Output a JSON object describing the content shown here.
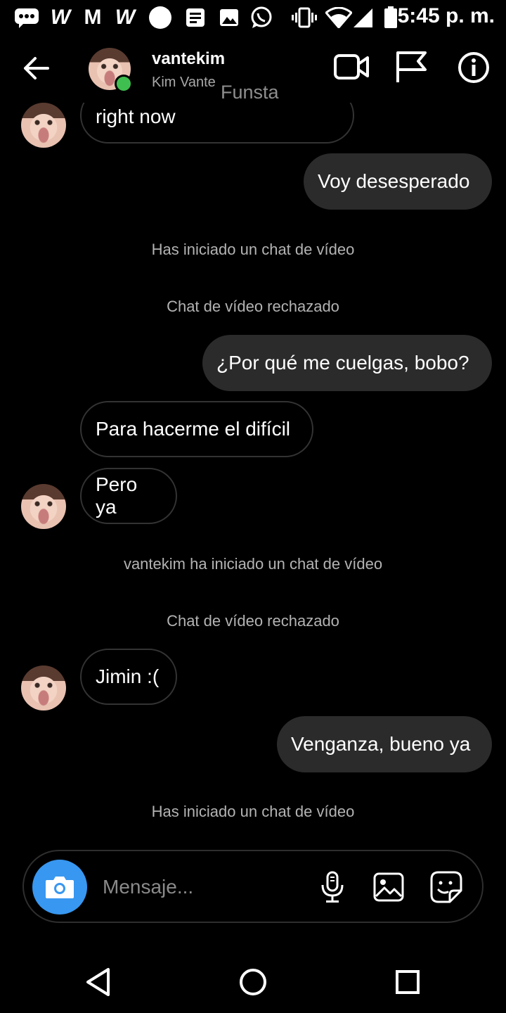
{
  "status_bar": {
    "time": "5:45 p. m.",
    "icons": [
      "message-icon",
      "wattpad-icon",
      "gmail-icon",
      "wattpad-icon",
      "circle-icon",
      "notes-icon",
      "gallery-icon",
      "whatsapp-icon",
      "vibrate-icon",
      "wifi-icon",
      "signal-icon",
      "battery-icon"
    ],
    "wattpad_glyph": "W",
    "gmail_glyph": "M"
  },
  "header": {
    "username": "vantekim",
    "full_name": "Kim Vante",
    "watermark": "Funsta",
    "online": true,
    "actions": [
      "video-call-icon",
      "flag-icon",
      "info-icon"
    ]
  },
  "messages": [
    {
      "type": "incoming",
      "text": "right now",
      "avatar": true
    },
    {
      "type": "outgoing",
      "text": "Voy desesperado"
    },
    {
      "type": "system",
      "text": "Has iniciado un chat de vídeo"
    },
    {
      "type": "system",
      "text": "Chat de vídeo rechazado"
    },
    {
      "type": "outgoing",
      "text": "¿Por qué me cuelgas, bobo?"
    },
    {
      "type": "incoming",
      "text": "Para hacerme el difícil",
      "avatar": false
    },
    {
      "type": "incoming",
      "text": "Pero ya",
      "avatar": true
    },
    {
      "type": "system",
      "text": "vantekim ha iniciado un chat de vídeo"
    },
    {
      "type": "system",
      "text": "Chat de vídeo rechazado"
    },
    {
      "type": "incoming",
      "text": "Jimin :(",
      "avatar": true
    },
    {
      "type": "outgoing",
      "text": "Venganza, bueno ya"
    },
    {
      "type": "system",
      "text": "Has iniciado un chat de vídeo"
    }
  ],
  "composer": {
    "placeholder": "Mensaje...",
    "value": "",
    "icons": [
      "camera-icon",
      "microphone-icon",
      "gallery-icon",
      "sticker-icon"
    ]
  },
  "nav_bar": {
    "buttons": [
      "back-triangle-icon",
      "home-circle-icon",
      "recents-square-icon"
    ]
  },
  "colors": {
    "background": "#000000",
    "outgoing_bubble": "#2b2b2b",
    "incoming_border": "#333333",
    "camera_button": "#3897f0",
    "online": "#3fbf4f",
    "system_text": "#b3b3b3"
  }
}
